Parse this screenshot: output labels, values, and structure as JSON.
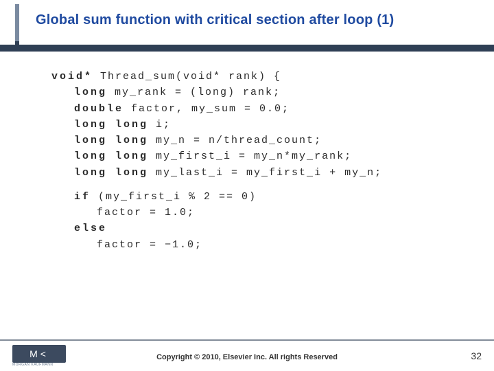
{
  "slide": {
    "title": "Global sum function with critical section after loop (1)",
    "page_number": "32",
    "copyright": "Copyright © 2010, Elsevier Inc. All rights Reserved",
    "logo": {
      "text": "M<",
      "subtext": "MORGAN KAUFMANN"
    }
  },
  "code": {
    "l0_kw": "void*",
    "l0_rest": " Thread_sum(void* rank) {",
    "l1_kw": "long",
    "l1_rest": " my_rank = (long) rank;",
    "l2_kw": "double",
    "l2_rest": " factor, my_sum = 0.0;",
    "l3_kw": "long long",
    "l3_rest": " i;",
    "l4_kw": "long long",
    "l4_rest": " my_n = n/thread_count;",
    "l5_kw": "long long",
    "l5_rest": " my_first_i = my_n*my_rank;",
    "l6_kw": "long long",
    "l6_rest": " my_last_i = my_first_i + my_n;",
    "l7_kw": "if",
    "l7_rest": " (my_first_i % 2 == 0)",
    "l8_rest": "      factor = 1.0;",
    "l9_kw": "else",
    "l10_rest": "      factor = −1.0;"
  }
}
